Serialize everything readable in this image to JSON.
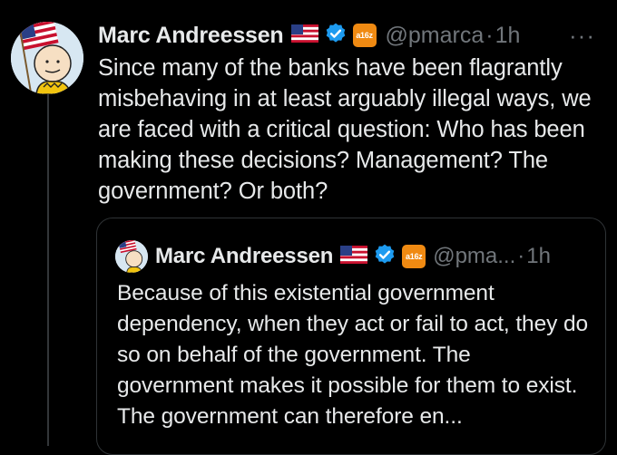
{
  "tweet": {
    "author_name": "Marc Andreessen",
    "handle": "@pmarca",
    "separator": "·",
    "time": "1h",
    "more_label": "···",
    "text": "Since many of the banks have been flagrantly misbehaving in at least arguably illegal ways, we are faced with a critical question: Who has been making these decisions? Management? The government? Or both?",
    "icons": [
      "avatar-peanuts-flag",
      "us-flag-icon",
      "verified-badge-icon",
      "a16z-badge-icon",
      "more-options-icon"
    ]
  },
  "badge": {
    "a16z_label": "a16z"
  },
  "quoted_tweet": {
    "author_name": "Marc Andreessen",
    "handle": "@pma...",
    "separator": "·",
    "time": "1h",
    "text": "Because of this existential government dependency, when they act or fail to act, they do so on behalf of the government. The government makes it possible for them to exist. The government can therefore en..."
  },
  "colors": {
    "background": "#000000",
    "text": "#e7e9ea",
    "secondary": "#71767b",
    "verified": "#1d9bf0",
    "a16z": "#f08a12",
    "border": "#2f3336"
  }
}
